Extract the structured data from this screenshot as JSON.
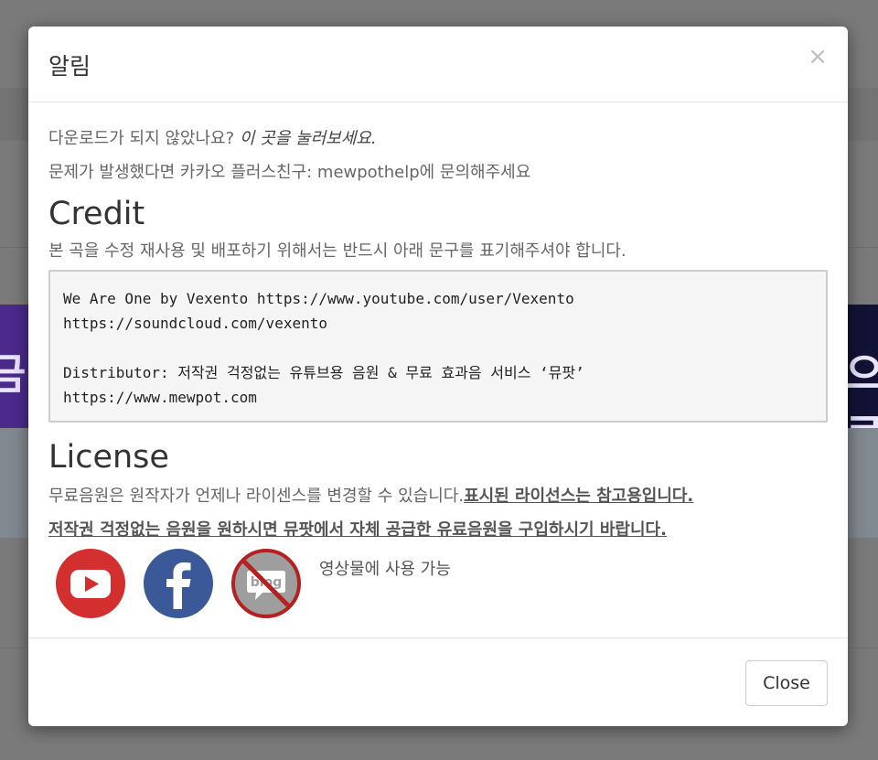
{
  "background": {
    "banner_left_glyph": "금",
    "banner_right_glyph": "으로"
  },
  "modal": {
    "title": "알림",
    "close_symbol": "×",
    "body": {
      "download_prompt": "다운로드가 되지 않았나요?",
      "download_link": "이 곳을 눌러보세요.",
      "help_text": "문제가 발생했다면 카카오 플러스친구: mewpothelp에 문의해주세요",
      "credit_heading": "Credit",
      "credit_instruction": "본 곡을 수정 재사용 및 배포하기 위해서는 반드시 아래 문구를 표기해주셔야 합니다.",
      "credit_lines": {
        "line1": "We Are One by Vexento https://www.youtube.com/user/Vexento",
        "line2": "https://soundcloud.com/vexento",
        "line3": "Distributor: 저작권 걱정없는 유튜브용 음원 & 무료 효과음 서비스 ‘뮤팟’",
        "line4": "https://www.mewpot.com"
      },
      "license_heading": "License",
      "license_text": "무료음원은 원작자가 언제나 라이센스를 변경할 수 있습니다.",
      "license_bold": "표시된 라이선스는 참고용입니다.",
      "license_recommend": "저작권 걱정없는 음원을 원하시면 뮤팟에서 자체 공급한 유료음원을 구입하시기 바랍니다.",
      "blog_icon_text": "blog",
      "usage_text": "영상물에 사용 가능"
    },
    "footer": {
      "close_label": "Close"
    }
  },
  "colors": {
    "youtube": "#d32f2f",
    "facebook": "#3b5998",
    "blog_prohibited": "#b52020"
  },
  "icons": [
    "youtube-icon",
    "facebook-icon",
    "blog-prohibited-icon"
  ]
}
